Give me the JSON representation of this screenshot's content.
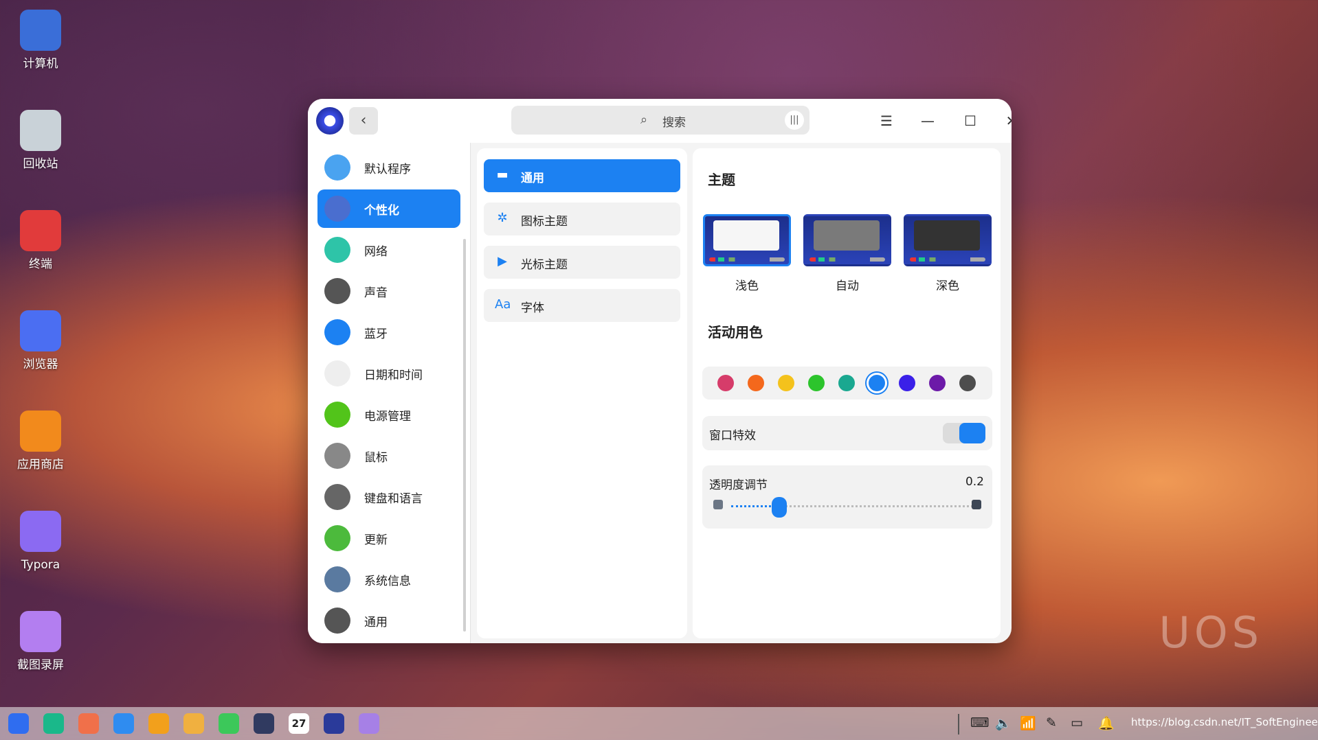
{
  "desktop": {
    "icons": [
      {
        "label": "计算机",
        "color": "#3a6ed8"
      },
      {
        "label": "回收站",
        "color": "#c9d2d8"
      },
      {
        "label": "终端",
        "color": "#e13b3b"
      },
      {
        "label": "浏览器",
        "color": "#4b6ef2"
      },
      {
        "label": "应用商店",
        "color": "#f28a1c"
      },
      {
        "label": "Typora",
        "color": "#8b6af2"
      },
      {
        "label": "截图录屏",
        "color": "#b37ef0"
      }
    ],
    "watermark": "UOS"
  },
  "window": {
    "search_placeholder": "搜索",
    "menu_icon": "☰",
    "minimize_icon": "—",
    "maximize_icon": "☐",
    "close_icon": "✕",
    "back_icon": "‹"
  },
  "sidebar": {
    "items": [
      {
        "label": "默认程序",
        "icon": "default-apps-icon",
        "color": "#4aa3f0"
      },
      {
        "label": "个性化",
        "icon": "personalization-icon",
        "color": "#4a6ecf"
      },
      {
        "label": "网络",
        "icon": "network-icon",
        "color": "#2ec4a8"
      },
      {
        "label": "声音",
        "icon": "sound-icon",
        "color": "#555555"
      },
      {
        "label": "蓝牙",
        "icon": "bluetooth-icon",
        "color": "#1c81f2"
      },
      {
        "label": "日期和时间",
        "icon": "clock-icon",
        "color": "#eeeeee"
      },
      {
        "label": "电源管理",
        "icon": "battery-icon",
        "color": "#52c41a"
      },
      {
        "label": "鼠标",
        "icon": "mouse-icon",
        "color": "#888888"
      },
      {
        "label": "键盘和语言",
        "icon": "keyboard-icon",
        "color": "#666666"
      },
      {
        "label": "更新",
        "icon": "update-icon",
        "color": "#4cba3c"
      },
      {
        "label": "系统信息",
        "icon": "system-info-icon",
        "color": "#5a7aa0"
      },
      {
        "label": "通用",
        "icon": "gear-icon",
        "color": "#555555"
      }
    ],
    "active_index": 1
  },
  "middle": {
    "items": [
      {
        "label": "通用",
        "glyph": "▬"
      },
      {
        "label": "图标主题",
        "glyph": "✲"
      },
      {
        "label": "光标主题",
        "glyph": "▶"
      },
      {
        "label": "字体",
        "glyph": "Aa"
      }
    ],
    "active_index": 0
  },
  "right": {
    "theme_heading": "主题",
    "themes": [
      {
        "label": "浅色",
        "window_color": "#f6f6f6"
      },
      {
        "label": "自动",
        "window_color": "#7a7a7a"
      },
      {
        "label": "深色",
        "window_color": "#333333"
      }
    ],
    "selected_theme": 0,
    "accent_heading": "活动用色",
    "accent_colors": [
      "#d63c6a",
      "#f4681c",
      "#f4c21c",
      "#2cc42c",
      "#1aa890",
      "#1c81f2",
      "#3a20e8",
      "#6c1aa8",
      "#4d4d4d"
    ],
    "selected_accent": 5,
    "window_effect_label": "窗口特效",
    "window_effect_on": true,
    "opacity_label": "透明度调节",
    "opacity_value": "0.2",
    "opacity_fraction": 0.2
  },
  "taskbar": {
    "date_badge": "27",
    "url_text": "https://blog.csdn.net/IT_SoftEngineer"
  }
}
